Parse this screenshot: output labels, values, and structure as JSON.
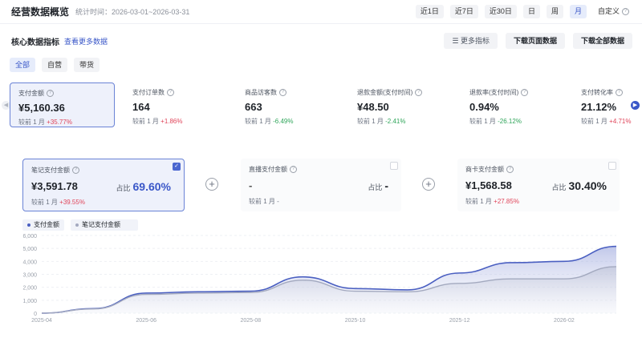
{
  "header": {
    "title": "经营数据概览",
    "stat_time": "统计时间：2026-03-01~2026-03-31",
    "ranges": [
      "近1日",
      "近7日",
      "近30日",
      "日",
      "周",
      "月",
      "自定义"
    ],
    "active_range": "月"
  },
  "section": {
    "title": "核心数据指标",
    "link": "查看更多数据",
    "more_metrics": "更多指标",
    "download_page": "下载页面数据",
    "download_all": "下载全部数据"
  },
  "filters": [
    "全部",
    "自营",
    "带货"
  ],
  "metrics": [
    {
      "label": "支付金额",
      "value": "¥5,160.36",
      "cmp_label": "较前 1 月",
      "cmp": "+35.77%",
      "dir": "up"
    },
    {
      "label": "支付订单数",
      "value": "164",
      "cmp_label": "较前 1 月",
      "cmp": "+1.86%",
      "dir": "up"
    },
    {
      "label": "商品访客数",
      "value": "663",
      "cmp_label": "较前 1 月",
      "cmp": "-6.49%",
      "dir": "down"
    },
    {
      "label": "退款金额(支付时间)",
      "value": "¥48.50",
      "cmp_label": "较前 1 月",
      "cmp": "-2.41%",
      "dir": "down"
    },
    {
      "label": "退款率(支付时间)",
      "value": "0.94%",
      "cmp_label": "较前 1 月",
      "cmp": "-26.12%",
      "dir": "down"
    },
    {
      "label": "支付转化率",
      "value": "21.12%",
      "cmp_label": "较前 1 月",
      "cmp": "+4.71%",
      "dir": "up"
    }
  ],
  "breakdown": [
    {
      "label": "笔记支付金额",
      "value": "¥3,591.78",
      "share_label": "占比",
      "share": "69.60%",
      "cmp_label": "较前 1 月",
      "cmp": "+39.55%"
    },
    {
      "label": "直播支付金额",
      "value": "-",
      "share_label": "占比",
      "share": "-",
      "cmp_label": "较前 1 月",
      "cmp": "-"
    },
    {
      "label": "商卡支付金额",
      "value": "¥1,568.58",
      "share_label": "占比",
      "share": "30.40%",
      "cmp_label": "较前 1 月",
      "cmp": "+27.85%"
    }
  ],
  "chart_data": {
    "type": "area",
    "x": [
      "2025-04",
      "2025-05",
      "2025-06",
      "2025-07",
      "2025-08",
      "2025-09",
      "2025-10",
      "2025-11",
      "2025-12",
      "2026-01",
      "2026-02",
      "2026-03"
    ],
    "x_ticks": [
      "2025-04",
      "2025-06",
      "2025-08",
      "2025-10",
      "2025-12",
      "2026-02"
    ],
    "y_ticks": [
      "6,000",
      "5,000",
      "4,000",
      "3,000",
      "2,000",
      "1,000",
      "0"
    ],
    "ylim": [
      0,
      6000
    ],
    "series": [
      {
        "name": "支付金额",
        "color": "#4a5fc1",
        "values": [
          0,
          350,
          1550,
          1650,
          1700,
          2800,
          1900,
          1800,
          3100,
          3900,
          4000,
          5160
        ]
      },
      {
        "name": "笔记支付金额",
        "color": "#a3a9bf",
        "values": [
          0,
          330,
          1450,
          1550,
          1600,
          2550,
          1700,
          1650,
          2300,
          2650,
          2650,
          3590
        ]
      }
    ],
    "legend_position": "top-left",
    "grid": true
  },
  "colors": {
    "accent": "#3a57c8",
    "up": "#e0455a",
    "down": "#2fa55a"
  },
  "icons": {
    "help": "help-icon",
    "check": "check-icon",
    "plus": "plus-icon",
    "prev": "chevron-left-icon",
    "next": "chevron-right-icon"
  }
}
